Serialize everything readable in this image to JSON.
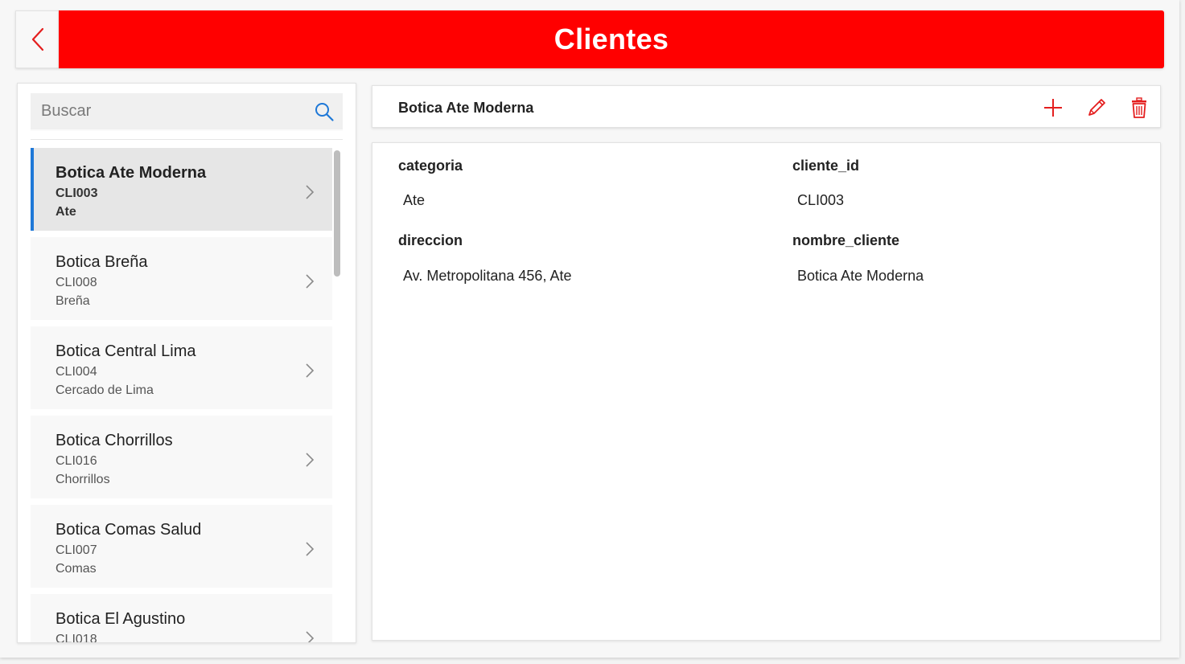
{
  "header": {
    "title": "Clientes",
    "back_icon": "chevron-left-icon",
    "accent_color": "#ff0000"
  },
  "search": {
    "placeholder": "Buscar",
    "icon": "search-icon"
  },
  "list": {
    "items": [
      {
        "title": "Botica Ate Moderna",
        "id": "CLI003",
        "district": "Ate",
        "selected": true
      },
      {
        "title": "Botica Breña",
        "id": "CLI008",
        "district": "Breña"
      },
      {
        "title": "Botica Central Lima",
        "id": "CLI004",
        "district": "Cercado de Lima"
      },
      {
        "title": "Botica Chorrillos",
        "id": "CLI016",
        "district": "Chorrillos"
      },
      {
        "title": "Botica Comas Salud",
        "id": "CLI007",
        "district": "Comas"
      },
      {
        "title": "Botica El Agustino",
        "id": "CLI018",
        "district": ""
      }
    ],
    "selection_color": "#1e78d7"
  },
  "detail": {
    "title": "Botica Ate Moderna",
    "actions": [
      "add-icon",
      "edit-icon",
      "delete-icon"
    ],
    "fields": {
      "categoria": {
        "label": "categoria",
        "value": "Ate"
      },
      "cliente_id": {
        "label": "cliente_id",
        "value": "CLI003"
      },
      "direccion": {
        "label": "direccion",
        "value": "Av. Metropolitana 456, Ate"
      },
      "nombre_cliente": {
        "label": "nombre_cliente",
        "value": "Botica Ate Moderna"
      }
    }
  }
}
